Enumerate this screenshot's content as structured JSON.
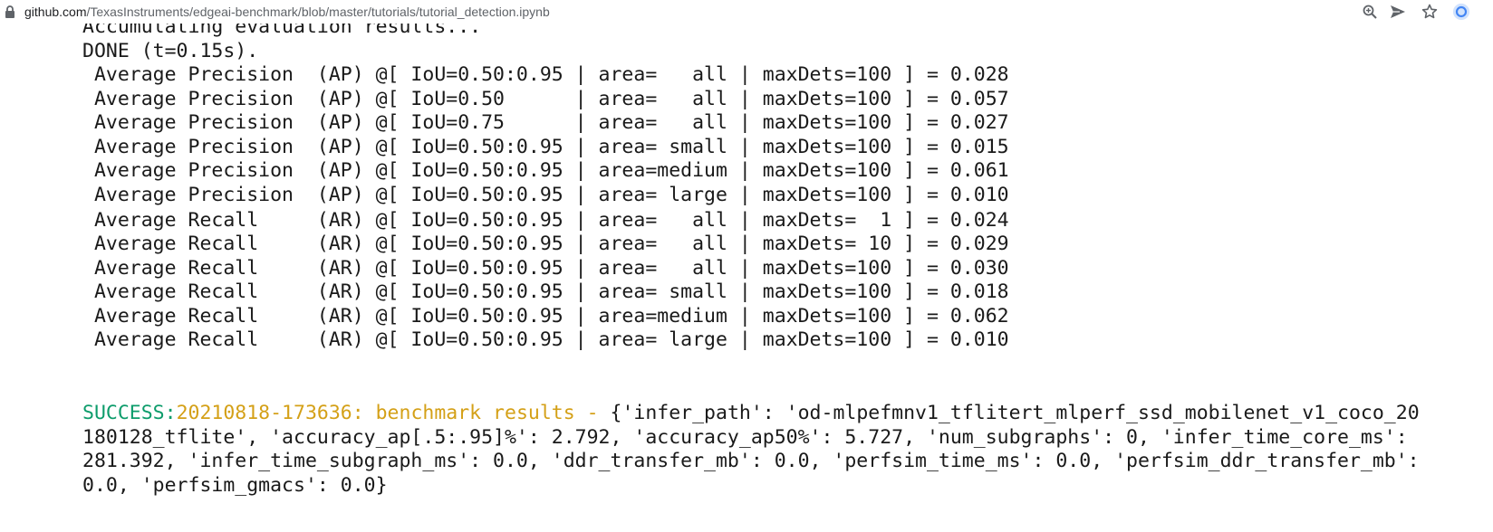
{
  "browser": {
    "url_host": "github.com",
    "url_path": "/TexasInstruments/edgeai-benchmark/blob/master/tutorials/tutorial_detection.ipynb",
    "icons": [
      "lock-icon",
      "zoom-icon",
      "share-icon",
      "star-icon",
      "profile-icon"
    ]
  },
  "output": {
    "partial_line": "Accumulating evaluation results...",
    "done_line": "DONE (t=0.15s).",
    "metrics": [
      " Average Precision  (AP) @[ IoU=0.50:0.95 | area=   all | maxDets=100 ] = 0.028",
      " Average Precision  (AP) @[ IoU=0.50      | area=   all | maxDets=100 ] = 0.057",
      " Average Precision  (AP) @[ IoU=0.75      | area=   all | maxDets=100 ] = 0.027",
      " Average Precision  (AP) @[ IoU=0.50:0.95 | area= small | maxDets=100 ] = 0.015",
      " Average Precision  (AP) @[ IoU=0.50:0.95 | area=medium | maxDets=100 ] = 0.061",
      " Average Precision  (AP) @[ IoU=0.50:0.95 | area= large | maxDets=100 ] = 0.010",
      " Average Recall     (AR) @[ IoU=0.50:0.95 | area=   all | maxDets=  1 ] = 0.024",
      " Average Recall     (AR) @[ IoU=0.50:0.95 | area=   all | maxDets= 10 ] = 0.029",
      " Average Recall     (AR) @[ IoU=0.50:0.95 | area=   all | maxDets=100 ] = 0.030",
      " Average Recall     (AR) @[ IoU=0.50:0.95 | area= small | maxDets=100 ] = 0.018",
      " Average Recall     (AR) @[ IoU=0.50:0.95 | area=medium | maxDets=100 ] = 0.062",
      " Average Recall     (AR) @[ IoU=0.50:0.95 | area= large | maxDets=100 ] = 0.010"
    ],
    "success": {
      "label": "SUCCESS:",
      "timestamp_text": "20210818-173636: benchmark results - ",
      "line1_rest": "{'infer_path': 'od-mlpefmnv1_tflitert_mlperf_ssd_mobilenet_v1_coco_20",
      "line2": "180128_tflite', 'accuracy_ap[.5:.95]%': 2.792, 'accuracy_ap50%': 5.727, 'num_subgraphs': 0, 'infer_time_core_ms':",
      "line3": "281.392, 'infer_time_subgraph_ms': 0.0, 'ddr_transfer_mb': 0.0, 'perfsim_time_ms': 0.0, 'perfsim_ddr_transfer_mb':",
      "line4": "0.0, 'perfsim_gmacs': 0.0}"
    }
  },
  "colors": {
    "success_green": "#0d9c6b",
    "timestamp_yellow": "#d4a017",
    "text": "#1a1a1a"
  }
}
